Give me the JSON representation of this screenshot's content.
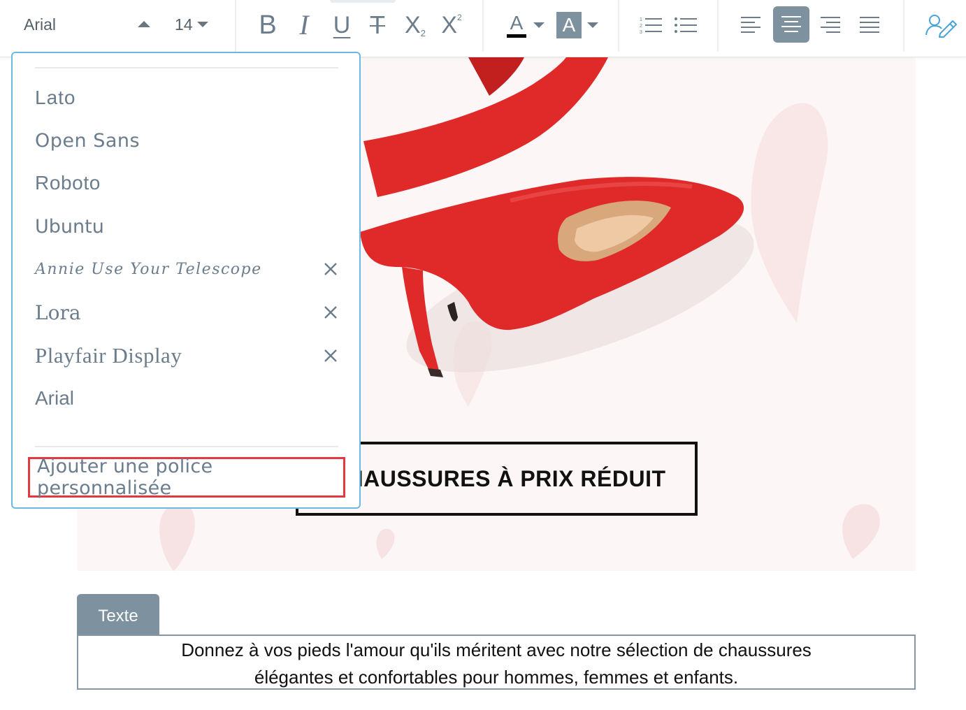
{
  "toolbar": {
    "font_name": "Arial",
    "font_size": "14",
    "bold": "B",
    "italic": "I",
    "underline": "U",
    "strike": "T",
    "subscript": "X",
    "superscript": "X",
    "text_color_letter": "A",
    "highlight_letter": "A",
    "active_align": "center"
  },
  "font_dropdown": {
    "fonts": [
      {
        "label": "Lato",
        "removable": false
      },
      {
        "label": "Open Sans",
        "removable": false
      },
      {
        "label": "Roboto",
        "removable": false
      },
      {
        "label": "Ubuntu",
        "removable": false
      },
      {
        "label": "Annie Use Your Telescope",
        "removable": true
      },
      {
        "label": "Lora",
        "removable": true
      },
      {
        "label": "Playfair Display",
        "removable": true
      },
      {
        "label": "Arial",
        "removable": false
      }
    ],
    "add_custom_font": "Ajouter une police personnalisée"
  },
  "canvas": {
    "banner_text": "HAUSSURES À PRIX RÉDUIT"
  },
  "text_block": {
    "tab_label": "Texte",
    "line1": "Donnez à vos pieds l'amour qu'ils méritent avec notre sélection de chaussures",
    "line2": "élégantes et confortables pour hommes, femmes et enfants."
  },
  "colors": {
    "accent": "#7e919f",
    "dropdown_border": "#6cb8e0",
    "highlight_border": "#e2383f",
    "shoe_red": "#e02a2a",
    "background_pink": "#fdf6f6"
  }
}
